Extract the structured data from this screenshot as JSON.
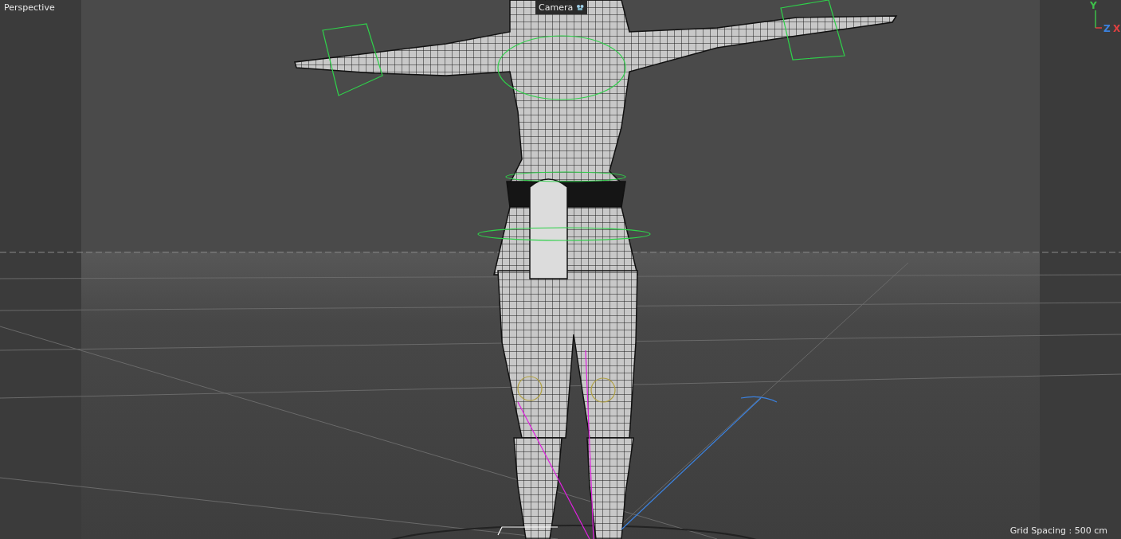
{
  "viewport": {
    "name": "Perspective",
    "camera": "Camera",
    "grid_spacing": "Grid Spacing : 500 cm",
    "axes": [
      {
        "label": "Y",
        "color": "#3ec04a"
      },
      {
        "label": "Z",
        "color": "#3b82e0"
      },
      {
        "label": "X",
        "color": "#e04040"
      }
    ]
  }
}
